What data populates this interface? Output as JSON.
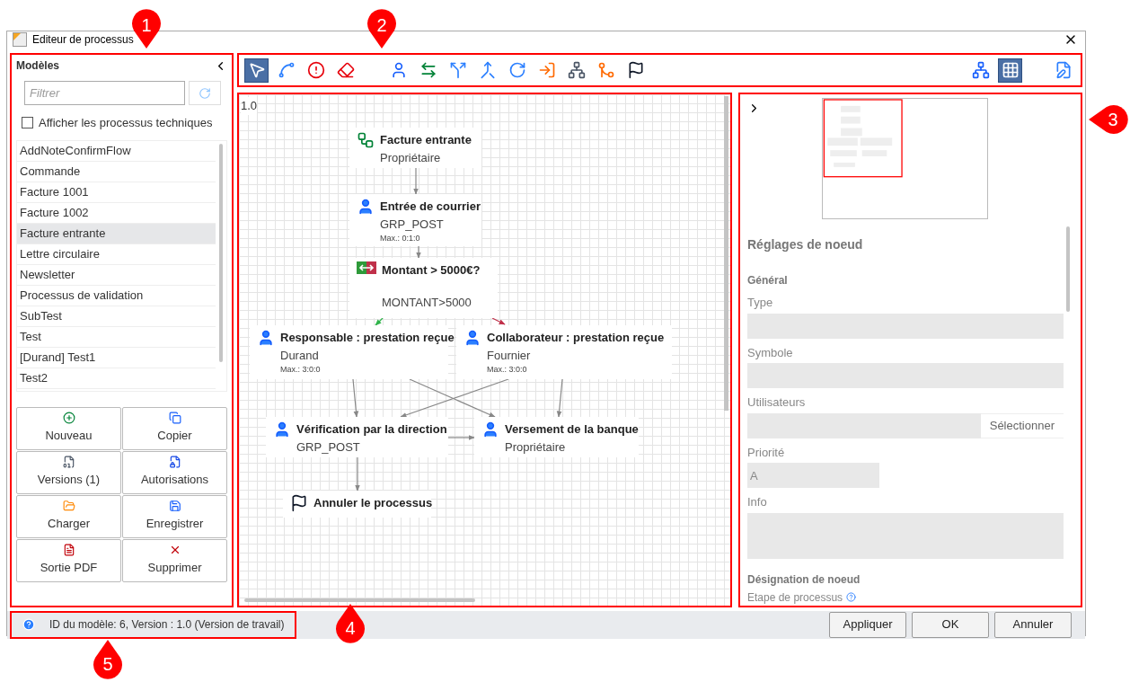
{
  "window": {
    "title": "Editeur de processus"
  },
  "callouts": [
    {
      "label": "1"
    },
    {
      "label": "2"
    },
    {
      "label": "3"
    },
    {
      "label": "4"
    },
    {
      "label": "5"
    }
  ],
  "models_panel": {
    "title": "Modèles",
    "filter": {
      "placeholder": "Filtrer"
    },
    "show_technical": {
      "label": "Afficher les processus techniques",
      "checked": false
    },
    "items": [
      {
        "label": "AddNoteConfirmFlow",
        "selected": false
      },
      {
        "label": "Commande",
        "selected": false
      },
      {
        "label": "Facture 1001",
        "selected": false
      },
      {
        "label": "Facture 1002",
        "selected": false
      },
      {
        "label": "Facture entrante",
        "selected": true
      },
      {
        "label": "Lettre circulaire",
        "selected": false
      },
      {
        "label": "Newsletter",
        "selected": false
      },
      {
        "label": "Processus de validation",
        "selected": false
      },
      {
        "label": "SubTest",
        "selected": false
      },
      {
        "label": "Test",
        "selected": false
      },
      {
        "label": "[Durand] Test1",
        "selected": false
      },
      {
        "label": "Test2",
        "selected": false
      }
    ],
    "buttons": [
      {
        "label": "Nouveau",
        "kind": "new"
      },
      {
        "label": "Copier",
        "kind": "copy"
      },
      {
        "label": "Versions (1)",
        "kind": "versions"
      },
      {
        "label": "Autorisations",
        "kind": "permissions"
      },
      {
        "label": "Charger",
        "kind": "load"
      },
      {
        "label": "Enregistrer",
        "kind": "save"
      },
      {
        "label": "Sortie PDF",
        "kind": "pdf"
      },
      {
        "label": "Supprimer",
        "kind": "delete"
      }
    ]
  },
  "toolbar": {
    "edit_tools": [
      {
        "kind": "pointer",
        "selected": true
      },
      {
        "kind": "connector",
        "selected": false
      },
      {
        "kind": "error-connector",
        "selected": false
      },
      {
        "kind": "eraser",
        "selected": false
      }
    ],
    "node_tools": [
      {
        "kind": "user",
        "selected": false
      },
      {
        "kind": "decision",
        "selected": false
      },
      {
        "kind": "split",
        "selected": false
      },
      {
        "kind": "join",
        "selected": false
      },
      {
        "kind": "loop",
        "selected": false
      },
      {
        "kind": "exit",
        "selected": false
      },
      {
        "kind": "distribution",
        "selected": false
      },
      {
        "kind": "collect",
        "selected": false
      },
      {
        "kind": "end",
        "selected": false
      }
    ],
    "views": [
      {
        "kind": "layout",
        "selected": false
      },
      {
        "kind": "grid",
        "selected": true
      }
    ],
    "form_tool": {
      "kind": "form"
    }
  },
  "canvas": {
    "version": "1.0",
    "nodes": [
      {
        "kind": "start",
        "title": "Facture entrante",
        "subtitle": "Propriétaire"
      },
      {
        "kind": "user",
        "title": "Entrée de courrier",
        "subtitle": "GRP_POST",
        "limit": "Max.: 0:1:0"
      },
      {
        "kind": "decision",
        "title": "Montant > 5000€?",
        "subtitle": "MONTANT>5000"
      },
      {
        "kind": "user",
        "title": "Responsable : prestation reçue",
        "subtitle": "Durand",
        "limit": "Max.: 3:0:0"
      },
      {
        "kind": "user",
        "title": "Collaborateur : prestation reçue",
        "subtitle": "Fournier",
        "limit": "Max.: 3:0:0"
      },
      {
        "kind": "user",
        "title": "Vérification par la direction",
        "subtitle": "GRP_POST"
      },
      {
        "kind": "user",
        "title": "Versement de la banque",
        "subtitle": "Propriétaire"
      },
      {
        "kind": "end",
        "title": "Annuler le processus"
      }
    ]
  },
  "properties": {
    "title": "Réglages de noeud",
    "section": "Général",
    "fields": [
      {
        "kind": "field",
        "label": "Type"
      },
      {
        "kind": "field",
        "label": "Symbole"
      },
      {
        "kind": "picker",
        "label": "Utilisateurs",
        "button": "Sélectionner"
      },
      {
        "kind": "narrow",
        "label": "Priorité",
        "value": "A"
      },
      {
        "kind": "area",
        "label": "Info"
      }
    ],
    "section2": "Désignation de noeud",
    "next_label": "Etape de processus"
  },
  "status_bar": {
    "text": "ID du modèle: 6, Version : 1.0 (Version de travail)",
    "buttons": [
      "Appliquer",
      "OK",
      "Annuler"
    ]
  }
}
